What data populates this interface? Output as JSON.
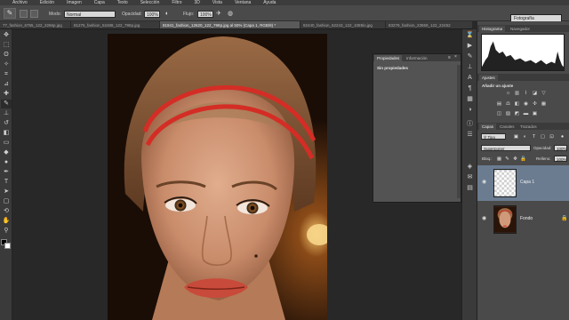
{
  "menu": [
    "Archivo",
    "Edición",
    "Imagen",
    "Capa",
    "Texto",
    "Selección",
    "Filtro",
    "3D",
    "Vista",
    "Ventana",
    "Ayuda"
  ],
  "options": {
    "mode_label": "Modo:",
    "mode_value": "Normal",
    "opacity_label": "Opacidad:",
    "opacity_value": "100%",
    "flow_label": "Flujo:",
    "flow_value": "100%",
    "workspace": "Fotografía"
  },
  "tabs": [
    "77_fashion_6755_122_2266p.jpg",
    "81275_fashion_52488_122_798p.jpg",
    "81941_fashion_12620_122_798p.jpg al 50% (Capa 1, RGB/8) *",
    "82440_fashion_62243_122_1085lo.jpg",
    "83279_fashion_23559_122_22452"
  ],
  "properties": {
    "tab_properties": "Propiedades",
    "tab_info": "Información",
    "empty_text": "Sin propiedades"
  },
  "histogram": {
    "tab_histogram": "Histograma",
    "tab_navigator": "Navegador"
  },
  "adjustments": {
    "tab": "Ajustes",
    "add_label": "Añadir un ajuste"
  },
  "layers": {
    "tab_layers": "Capas",
    "tab_channels": "Canales",
    "tab_paths": "Trazados",
    "filter_kind": "Tipo",
    "blend_mode": "Superponer",
    "opacity_label": "Opacidad:",
    "opacity_value": "100%",
    "lock_label": "Bloq.:",
    "fill_label": "Relleno:",
    "fill_value": "100%",
    "items": [
      {
        "name": "Capa 1",
        "selected": true
      },
      {
        "name": "Fondo",
        "selected": false
      }
    ]
  },
  "colors": {
    "accent_selected": "#6b7c91",
    "headband": "#d42d25",
    "background": "#282828"
  }
}
